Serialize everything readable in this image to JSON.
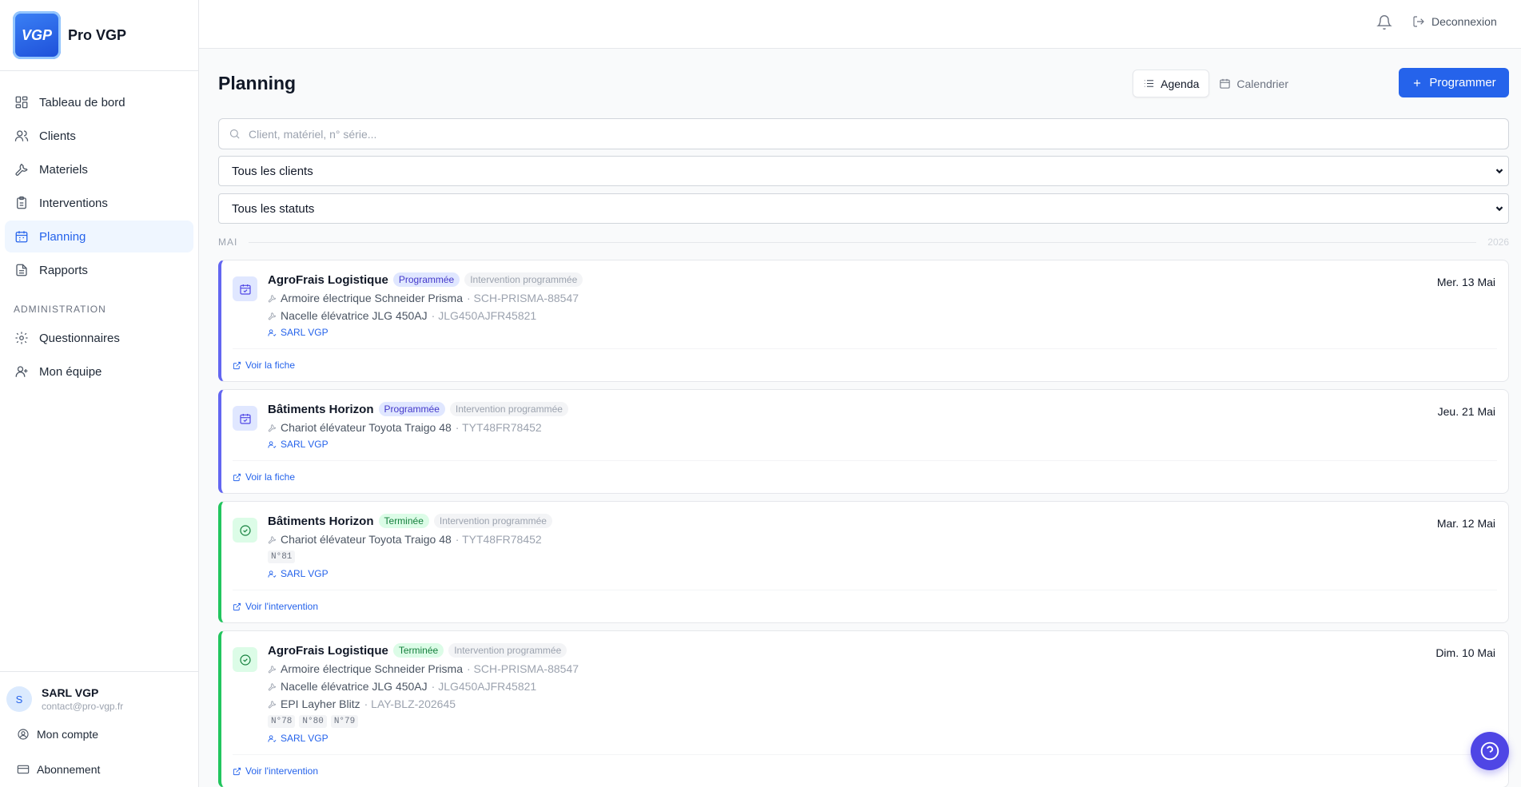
{
  "app": {
    "brand": "Pro VGP",
    "logo_text": "VGP"
  },
  "sidebar": {
    "items": [
      {
        "label": "Tableau de bord",
        "icon": "dashboard-icon"
      },
      {
        "label": "Clients",
        "icon": "users-icon"
      },
      {
        "label": "Materiels",
        "icon": "wrench-icon"
      },
      {
        "label": "Interventions",
        "icon": "clipboard-icon"
      },
      {
        "label": "Planning",
        "icon": "calendar-icon",
        "active": true
      },
      {
        "label": "Rapports",
        "icon": "file-icon"
      }
    ],
    "section_admin": "ADMINISTRATION",
    "admin_items": [
      {
        "label": "Questionnaires",
        "icon": "gear-icon"
      },
      {
        "label": "Mon équipe",
        "icon": "team-icon"
      }
    ],
    "user": {
      "initial": "S",
      "name": "SARL VGP",
      "email": "contact@pro-vgp.fr"
    },
    "footer": {
      "account": "Mon compte",
      "subscription": "Abonnement"
    }
  },
  "topbar": {
    "logout": "Deconnexion"
  },
  "page": {
    "title": "Planning",
    "view_agenda": "Agenda",
    "view_calendar": "Calendrier",
    "program_button": "Programmer",
    "search_placeholder": "Client, matériel, n° série...",
    "filter_clients": "Tous les clients",
    "filter_status": "Tous les statuts",
    "month": "MAI",
    "year": "2026"
  },
  "cards": [
    {
      "client": "AgroFrais Logistique",
      "status": "Programmée",
      "type": "Intervention programmée",
      "date": "Mer. 13 Mai",
      "equipment": [
        {
          "name": "Armoire électrique Schneider Prisma",
          "serial": "· SCH-PRISMA-88547"
        },
        {
          "name": "Nacelle élévatrice JLG 450AJ",
          "serial": "· JLG450AJFR45821"
        }
      ],
      "assignee": "SARL VGP",
      "link": "Voir la fiche"
    },
    {
      "client": "Bâtiments Horizon",
      "status": "Programmée",
      "type": "Intervention programmée",
      "date": "Jeu. 21 Mai",
      "equipment": [
        {
          "name": "Chariot élévateur Toyota Traigo 48",
          "serial": "· TYT48FR78452"
        }
      ],
      "assignee": "SARL VGP",
      "link": "Voir la fiche"
    },
    {
      "client": "Bâtiments Horizon",
      "status": "Terminée",
      "type": "Intervention programmée",
      "date": "Mar. 12 Mai",
      "equipment": [
        {
          "name": "Chariot élévateur Toyota Traigo 48",
          "serial": "· TYT48FR78452"
        }
      ],
      "chips": [
        "N°81"
      ],
      "assignee": "SARL VGP",
      "link": "Voir l'intervention"
    },
    {
      "client": "AgroFrais Logistique",
      "status": "Terminée",
      "type": "Intervention programmée",
      "date": "Dim. 10 Mai",
      "equipment": [
        {
          "name": "Armoire électrique Schneider Prisma",
          "serial": "· SCH-PRISMA-88547"
        },
        {
          "name": "Nacelle élévatrice JLG 450AJ",
          "serial": "· JLG450AJFR45821"
        },
        {
          "name": "EPI Layher Blitz",
          "serial": "· LAY-BLZ-202645"
        }
      ],
      "chips": [
        "N°78",
        "N°80",
        "N°79"
      ],
      "assignee": "SARL VGP",
      "link": "Voir l'intervention"
    }
  ],
  "colors": {
    "accent": "#2563eb",
    "scheduled": "#6366f1",
    "done": "#22c55e"
  }
}
